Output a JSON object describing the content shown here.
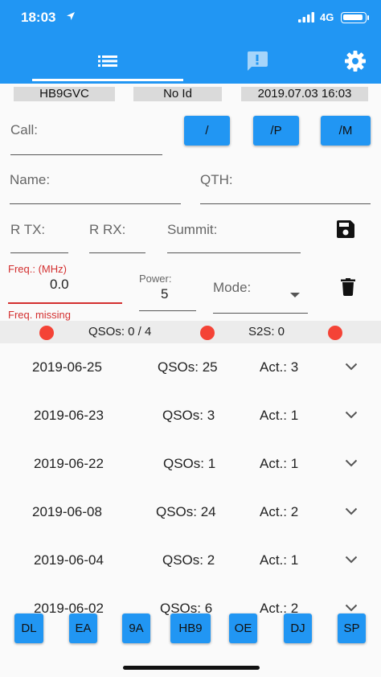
{
  "status_bar": {
    "time": "18:03",
    "network": "4G"
  },
  "tabs": [
    {
      "name": "list",
      "icon": "list-icon"
    },
    {
      "name": "messages",
      "icon": "feedback-icon"
    },
    {
      "name": "settings",
      "icon": "gear-icon"
    }
  ],
  "info": {
    "callsign": "HB9GVC",
    "id": "No Id",
    "datetime": "2019.07.03 16:03"
  },
  "form": {
    "call_label": "Call:",
    "suffix_buttons": [
      "/",
      "/P",
      "/M"
    ],
    "name_label": "Name:",
    "qth_label": "QTH:",
    "rtx_label": "R TX:",
    "rrx_label": "R RX:",
    "summit_label": "Summit:",
    "freq_label": "Freq.: (MHz)",
    "freq_value": "0.0",
    "freq_error": "Freq. missing",
    "power_label": "Power:",
    "power_value": "5",
    "mode_label": "Mode:"
  },
  "status_strip": {
    "qsos": "QSOs: 0 / 4",
    "s2s": "S2S: 0"
  },
  "log_rows": [
    {
      "date": "2019-06-25",
      "qsos": "QSOs: 25",
      "act": "Act.: 3"
    },
    {
      "date": "2019-06-23",
      "qsos": "QSOs: 3",
      "act": "Act.: 1"
    },
    {
      "date": "2019-06-22",
      "qsos": "QSOs: 1",
      "act": "Act.: 1"
    },
    {
      "date": "2019-06-08",
      "qsos": "QSOs: 24",
      "act": "Act.: 2"
    },
    {
      "date": "2019-06-04",
      "qsos": "QSOs: 2",
      "act": "Act.: 1"
    },
    {
      "date": "2019-06-02",
      "qsos": "QSOs: 6",
      "act": "Act.: 2"
    }
  ],
  "country_buttons": [
    "DL",
    "EA",
    "9A",
    "HB9",
    "OE",
    "DJ",
    "SP"
  ],
  "colors": {
    "primary": "#2196f3",
    "error": "#d32f2f",
    "status_dot": "#f44336"
  }
}
